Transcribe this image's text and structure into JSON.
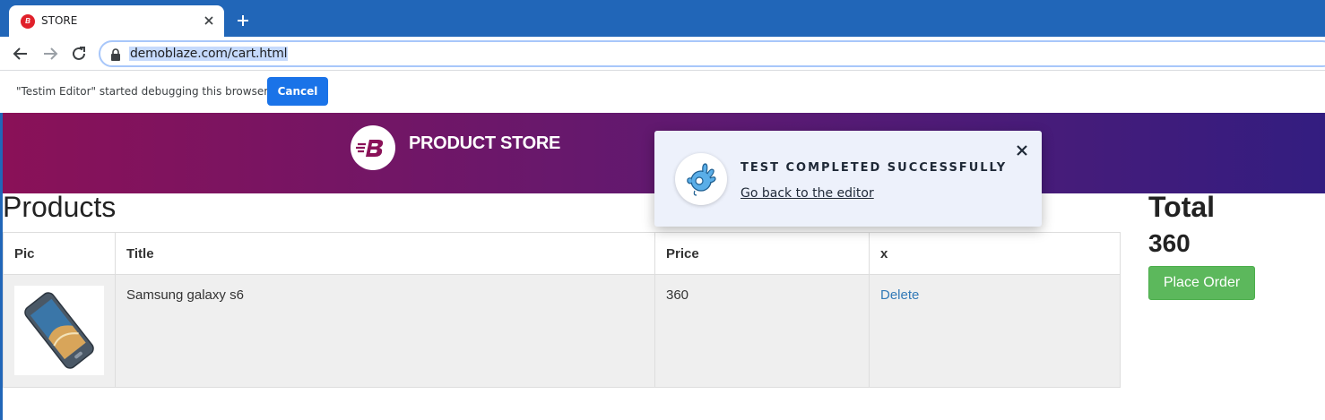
{
  "browser": {
    "tab_title": "STORE",
    "favicon_letter": "B",
    "url": "demoblaze.com/cart.html"
  },
  "infobar": {
    "message": "\"Testim Editor\" started debugging this browser",
    "cancel_label": "Cancel"
  },
  "store": {
    "brand": "PRODUCT STORE"
  },
  "cart": {
    "heading": "Products",
    "columns": [
      "Pic",
      "Title",
      "Price",
      "x"
    ],
    "rows": [
      {
        "title": "Samsung galaxy s6",
        "price": "360",
        "action": "Delete"
      }
    ]
  },
  "summary": {
    "total_label": "Total",
    "total_value": "360",
    "place_order_label": "Place Order"
  },
  "toast": {
    "title": "TEST COMPLETED SUCCESSFULLY",
    "link": "Go back to the editor"
  },
  "colors": {
    "tabstrip": "#2166b8",
    "header_start": "#8a1158",
    "header_end": "#331d80",
    "place_order": "#5cb85c",
    "link": "#337ab7",
    "cancel": "#1a73e8"
  }
}
